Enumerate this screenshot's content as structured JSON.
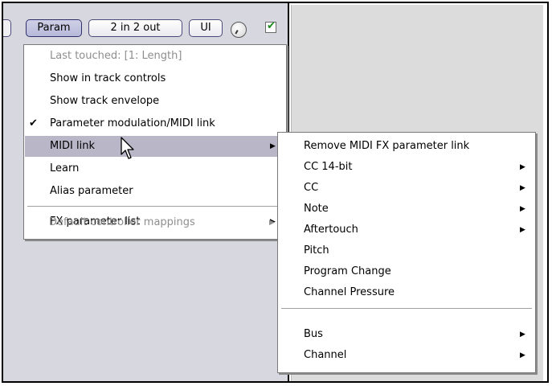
{
  "toolbar": {
    "param_label": "Param",
    "io_label": "2 in 2 out",
    "ui_label": "UI",
    "bypass_checked": true,
    "bypass_check_glyph": "✔",
    "knob_icon": "wet-dry-knob-icon"
  },
  "main_menu": {
    "items": [
      {
        "label": "Last touched: [1: Length]",
        "disabled": true
      },
      {
        "label": "Show in track controls"
      },
      {
        "label": "Show track envelope"
      },
      {
        "label": "Parameter modulation/MIDI link",
        "checked": true,
        "check_glyph": "✔"
      },
      {
        "label": "MIDI link",
        "highlighted": true,
        "submenu": true,
        "arrow": "▶"
      },
      {
        "label": "Learn"
      },
      {
        "label": "Alias parameter"
      },
      {
        "label": "FX parameter list",
        "submenu": true,
        "arrow": "▶"
      },
      {
        "label": "Default controller mappings",
        "disabled": true,
        "submenu": true,
        "arrow": "▶"
      }
    ]
  },
  "sub_menu": {
    "items": [
      {
        "label": "Remove MIDI FX parameter link"
      },
      {
        "label": "CC 14-bit",
        "submenu": true,
        "arrow": "▶"
      },
      {
        "label": "CC",
        "submenu": true,
        "arrow": "▶"
      },
      {
        "label": "Note",
        "submenu": true,
        "arrow": "▶"
      },
      {
        "label": "Aftertouch",
        "submenu": true,
        "arrow": "▶"
      },
      {
        "label": "Pitch"
      },
      {
        "label": "Program Change"
      },
      {
        "label": "Channel Pressure"
      },
      {
        "label": "Bus",
        "submenu": true,
        "arrow": "▶"
      },
      {
        "label": "Channel",
        "submenu": true,
        "arrow": "▶"
      }
    ]
  },
  "colors": {
    "panel_bg": "#d7d7df",
    "menu_highlight": "#b8b6c7",
    "check_green": "#1b8a1b",
    "disabled_text": "#8e8e8e"
  }
}
